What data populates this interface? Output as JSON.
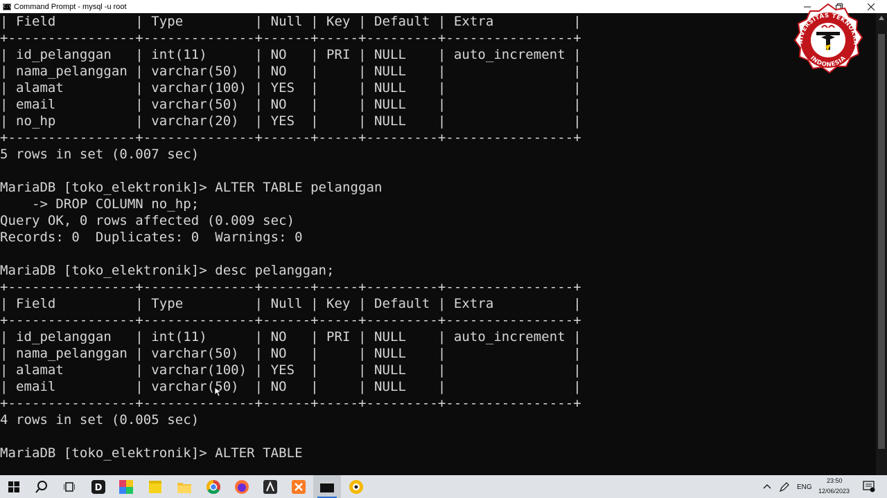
{
  "window": {
    "title": "Command Prompt - mysql  -u root",
    "icon": "cmd-icon",
    "controls": [
      "minimize-icon",
      "restore-icon",
      "close-icon"
    ]
  },
  "terminal": {
    "lines": [
      "| Field          | Type         | Null | Key | Default | Extra          |",
      "+----------------+--------------+------+-----+---------+----------------+",
      "| id_pelanggan   | int(11)      | NO   | PRI | NULL    | auto_increment |",
      "| nama_pelanggan | varchar(50)  | NO   |     | NULL    |                |",
      "| alamat         | varchar(100) | YES  |     | NULL    |                |",
      "| email          | varchar(50)  | NO   |     | NULL    |                |",
      "| no_hp          | varchar(20)  | YES  |     | NULL    |                |",
      "+----------------+--------------+------+-----+---------+----------------+",
      "5 rows in set (0.007 sec)",
      "",
      "MariaDB [toko_elektronik]> ALTER TABLE pelanggan",
      "    -> DROP COLUMN no_hp;",
      "Query OK, 0 rows affected (0.009 sec)",
      "Records: 0  Duplicates: 0  Warnings: 0",
      "",
      "MariaDB [toko_elektronik]> desc pelanggan;",
      "+----------------+--------------+------+-----+---------+----------------+",
      "| Field          | Type         | Null | Key | Default | Extra          |",
      "+----------------+--------------+------+-----+---------+----------------+",
      "| id_pelanggan   | int(11)      | NO   | PRI | NULL    | auto_increment |",
      "| nama_pelanggan | varchar(50)  | NO   |     | NULL    |                |",
      "| alamat         | varchar(100) | YES  |     | NULL    |                |",
      "| email          | varchar(50)  | NO   |     | NULL    |                |",
      "+----------------+--------------+------+-----+---------+----------------+",
      "4 rows in set (0.005 sec)",
      "",
      "MariaDB [toko_elektronik]> ALTER TABLE"
    ]
  },
  "logo": {
    "text": "UNIVERSITAS TEKNOKRAT INDONESIA",
    "colors": {
      "red": "#c0151b",
      "white": "#ffffff",
      "black": "#111111",
      "yellow": "#f2c200"
    }
  },
  "taskbar": {
    "apps": [
      "windows-start-icon",
      "search-icon",
      "task-view-icon",
      "davinci-resolve-icon",
      "color-app-icon",
      "sticky-notes-icon",
      "file-explorer-icon",
      "chrome-icon",
      "firefox-icon",
      "app-a-icon",
      "xampp-icon",
      "cmd-icon",
      "bandicam-icon"
    ],
    "active_app": "cmd-icon",
    "tray": {
      "language": "ENG",
      "time": "23:50",
      "date": "12/06/2023"
    }
  },
  "colors": {
    "terminal_bg": "#0c0c0c",
    "terminal_fg": "#d7d7d7",
    "taskbar_bg": "#dfe3e8",
    "accent": "#2a6fd1"
  }
}
